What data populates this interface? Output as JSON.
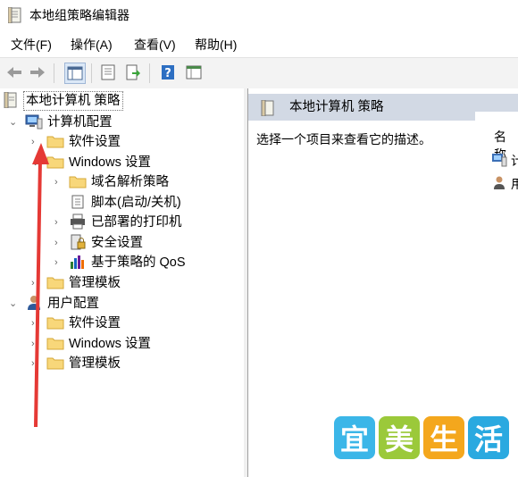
{
  "window": {
    "title": "本地组策略编辑器"
  },
  "menu": [
    {
      "label": "文件(F)"
    },
    {
      "label": "操作(A)"
    },
    {
      "label": "查看(V)"
    },
    {
      "label": "帮助(H)"
    }
  ],
  "toolbar": {
    "icons": [
      "back-icon",
      "forward-icon",
      "show-tree-icon",
      "properties-icon",
      "export-icon",
      "help-icon",
      "details-view-icon"
    ]
  },
  "tree": {
    "root": "本地计算机 策略",
    "computer_config": "计算机配置",
    "computer_software": "软件设置",
    "computer_windows": "Windows 设置",
    "name_resolution": "域名解析策略",
    "scripts": "脚本(启动/关机)",
    "printers": "已部署的打印机",
    "security": "安全设置",
    "qos": "基于策略的 QoS",
    "computer_admin": "管理模板",
    "user_config": "用户配置",
    "user_software": "软件设置",
    "user_windows": "Windows 设置",
    "user_admin": "管理模板"
  },
  "right": {
    "header": "本地计算机 策略",
    "description": "选择一个项目来查看它的描述。",
    "column_header": "名称",
    "items": [
      {
        "label": "计"
      },
      {
        "label": "用"
      }
    ]
  },
  "watermark": {
    "chars": [
      "宜",
      "美",
      "生",
      "活"
    ],
    "colors": [
      "#3bb6e8",
      "#9bc93a",
      "#f4a71d",
      "#2aa9e0"
    ]
  }
}
